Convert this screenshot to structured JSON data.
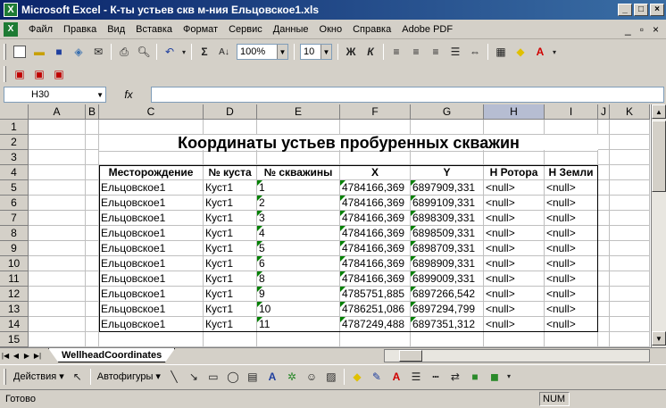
{
  "window": {
    "title": "Microsoft Excel - К-ты устьев скв м-ния Ельцовское1.xls",
    "app_icon": "excel-icon"
  },
  "menu": {
    "items": [
      "Файл",
      "Правка",
      "Вид",
      "Вставка",
      "Формат",
      "Сервис",
      "Данные",
      "Окно",
      "Справка",
      "Adobe PDF"
    ]
  },
  "toolbar": {
    "zoom": "100%",
    "font_size": "10",
    "bold_label": "Ж",
    "italic_label": "К",
    "sum_label": "Σ"
  },
  "formula": {
    "namebox": "H30",
    "fx_label": "fx",
    "content": ""
  },
  "sheet": {
    "columns": [
      "A",
      "B",
      "C",
      "D",
      "E",
      "F",
      "G",
      "H",
      "I",
      "J",
      "K"
    ],
    "selected_column": "H",
    "rows": [
      "1",
      "2",
      "3",
      "4",
      "5",
      "6",
      "7",
      "8",
      "9",
      "10",
      "11",
      "12",
      "13",
      "14",
      "15"
    ],
    "title": "Координаты устьев пробуренных скважин",
    "headers": [
      "Месторождение",
      "№ куста",
      "№ скважины",
      "X",
      "Y",
      "H Ротора",
      "H Земли"
    ],
    "data": [
      [
        "Ельцовское1",
        "Куст1",
        "1",
        "4784166,369",
        "6897909,331",
        "<null>",
        "<null>"
      ],
      [
        "Ельцовское1",
        "Куст1",
        "2",
        "4784166,369",
        "6899109,331",
        "<null>",
        "<null>"
      ],
      [
        "Ельцовское1",
        "Куст1",
        "3",
        "4784166,369",
        "6898309,331",
        "<null>",
        "<null>"
      ],
      [
        "Ельцовское1",
        "Куст1",
        "4",
        "4784166,369",
        "6898509,331",
        "<null>",
        "<null>"
      ],
      [
        "Ельцовское1",
        "Куст1",
        "5",
        "4784166,369",
        "6898709,331",
        "<null>",
        "<null>"
      ],
      [
        "Ельцовское1",
        "Куст1",
        "6",
        "4784166,369",
        "6898909,331",
        "<null>",
        "<null>"
      ],
      [
        "Ельцовское1",
        "Куст1",
        "8",
        "4784166,369",
        "6899009,331",
        "<null>",
        "<null>"
      ],
      [
        "Ельцовское1",
        "Куст1",
        "9",
        "4785751,885",
        "6897266,542",
        "<null>",
        "<null>"
      ],
      [
        "Ельцовское1",
        "Куст1",
        "10",
        "4786251,086",
        "6897294,799",
        "<null>",
        "<null>"
      ],
      [
        "Ельцовское1",
        "Куст1",
        "11",
        "4787249,488",
        "6897351,312",
        "<null>",
        "<null>"
      ]
    ],
    "tab": "WellheadCoordinates"
  },
  "drawing": {
    "actions_label": "Действия",
    "autoshapes_label": "Автофигуры"
  },
  "status": {
    "text": "Готово",
    "num": "NUM"
  },
  "colors": {
    "titlebar": "#0a246a",
    "face": "#d4d0c8",
    "selected_header": "#b6bdd2"
  }
}
